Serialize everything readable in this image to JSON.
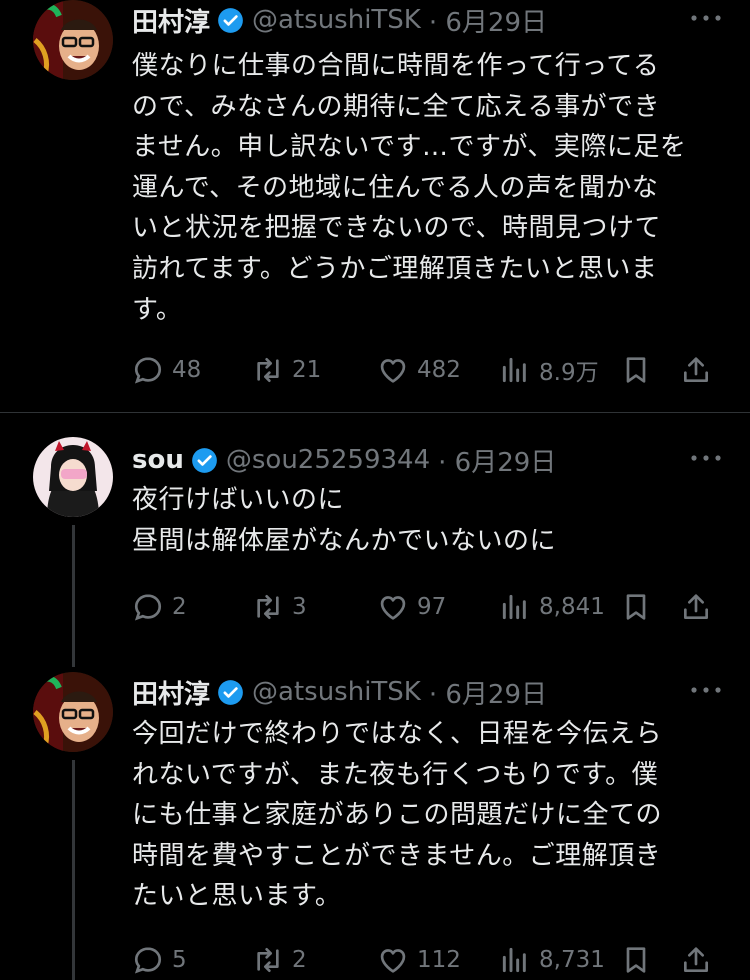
{
  "tweets": [
    {
      "name": "田村淳",
      "handle": "@atsushiTSK",
      "date": "· 6月29日",
      "text": "僕なりに仕事の合間に時間を作って行ってる\nので、みなさんの期待に全て応える事ができ\nません。申し訳ないです…ですが、実際に足を\n運んで、その地域に住んでる人の声を聞かな\nいと状況を把握できないので、時間見つけて\n訪れてます。どうかご理解頂きたいと思いま\nす。",
      "replies": "48",
      "retweets": "21",
      "likes": "482",
      "views": "8.9万"
    },
    {
      "name": "sou",
      "handle": "@sou25259344",
      "date": "· 6月29日",
      "text": "夜行けばいいのに\n昼間は解体屋がなんかでいないのに",
      "replies": "2",
      "retweets": "3",
      "likes": "97",
      "views": "8,841"
    },
    {
      "name": "田村淳",
      "handle": "@atsushiTSK",
      "date": "· 6月29日",
      "text": "今回だけで終わりではなく、日程を今伝えら\nれないですが、また夜も行くつもりです。僕\nにも仕事と家庭がありこの問題だけに全ての\n時間を費やすことができません。ご理解頂き\nたいと思います。",
      "replies": "5",
      "retweets": "2",
      "likes": "112",
      "views": "8,731"
    }
  ],
  "colors": {
    "background": "#000000",
    "text": "#e7e9ea",
    "muted": "#71767b",
    "verified": "#1d9bf0",
    "divider": "#2f3336"
  },
  "icons": [
    "verified-badge-icon",
    "more-icon",
    "reply-icon",
    "retweet-icon",
    "like-icon",
    "views-icon",
    "bookmark-icon",
    "share-icon"
  ]
}
